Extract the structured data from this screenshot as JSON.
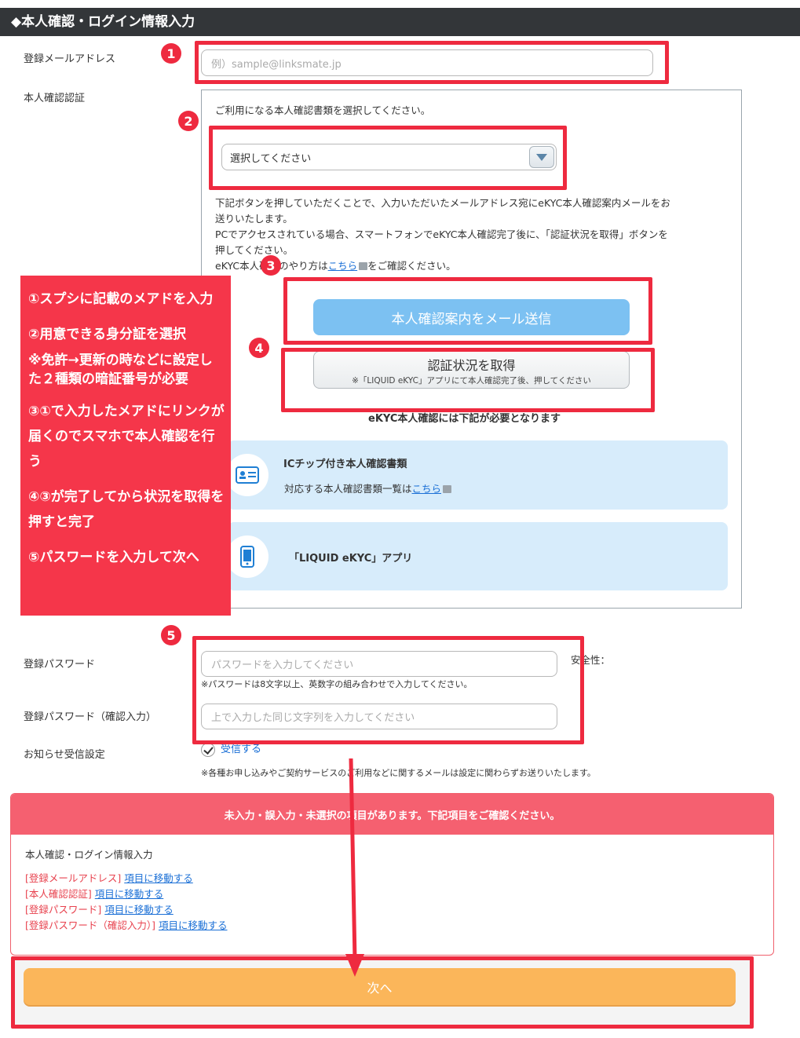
{
  "header": {
    "title": "◆本人確認・ログイン情報入力"
  },
  "email": {
    "label": "登録メールアドレス",
    "placeholder": "例）sample@linksmate.jp"
  },
  "identity": {
    "label": "本人確認認証",
    "prompt": "ご利用になる本人確認書類を選択してください。",
    "select_value": "選択してください",
    "desc1": "下記ボタンを押していただくことで、入力いただいたメールアドレス宛にeKYC本人確認案内メールをお",
    "desc2": "送りいたします。",
    "desc3": "PCでアクセスされている場合、スマートフォンでeKYC本人確認完了後に、「認証状況を取得」ボタンを",
    "desc4": "押してください。",
    "howto_pre": "eKYC本人確認のやり方は",
    "howto_link": "こちら",
    "howto_post": "をご確認ください。",
    "mail_button": "本人確認案内をメール送信",
    "status_button": "認証状況を取得",
    "status_button_sub": "※「LIQUID eKYC」アプリにて本人確認完了後、押してください",
    "requirement": "eKYC本人確認には下記が必要となります",
    "card1_title": "ICチップ付き本人確認書類",
    "card1_text": "対応する本人確認書類一覧は",
    "card1_link": "こちら",
    "card2_title": "「LIQUID eKYC」アプリ"
  },
  "annotation": {
    "line1": "①スプシに記載のメアドを入力",
    "line2": "②用意できる身分証を選択",
    "line2b": "※免許→更新の時などに設定した２種類の暗証番号が必要",
    "line3": "③①で入力したメアドにリンクが届くのでスマホで本人確認を行う",
    "line4": "④③が完了してから状況を取得を押すと完了",
    "line5": "⑤パスワードを入力して次へ"
  },
  "markers": [
    "1",
    "2",
    "3",
    "4",
    "5"
  ],
  "password": {
    "label": "登録パスワード",
    "placeholder": "パスワードを入力してください",
    "strength_label": "安全性：",
    "hint": "※パスワードは8文字以上、英数字の組み合わせで入力してください。",
    "confirm_label": "登録パスワード（確認入力）",
    "confirm_placeholder": "上で入力した同じ文字列を入力してください"
  },
  "notice": {
    "label": "お知らせ受信設定",
    "checkbox_label": "受信する",
    "note": "※各種お申し込みやご契約サービスのご利用などに関するメールは設定に関わらずお送りいたします。"
  },
  "errors": {
    "header": "未入力・誤入力・未選択の項目があります。下記項目をご確認ください。",
    "section": "本人確認・ログイン情報入力",
    "items": [
      {
        "field": "[登録メールアドレス]",
        "link": "項目に移動する"
      },
      {
        "field": "[本人確認認証]",
        "link": "項目に移動する"
      },
      {
        "field": "[登録パスワード]",
        "link": "項目に移動する"
      },
      {
        "field": "[登録パスワード（確認入力）]",
        "link": "項目に移動する"
      }
    ]
  },
  "next_button": "次へ",
  "colors": {
    "accent_red": "#ee2a3f",
    "next_orange": "#fbb65a",
    "mail_blue": "#7cc1f2",
    "info_blue": "#d7ecfb"
  }
}
